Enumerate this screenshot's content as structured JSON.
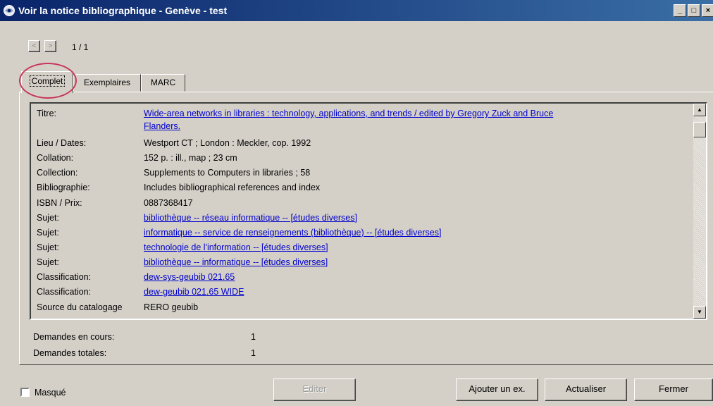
{
  "window": {
    "title": "Voir la notice bibliographique - Genève - test",
    "controls": {
      "minimize": "_",
      "maximize": "□",
      "close": "×"
    }
  },
  "navigation": {
    "prev": "<",
    "next": ">",
    "counter": "1 / 1"
  },
  "tabs": [
    {
      "label": "Complet",
      "active": true
    },
    {
      "label": "Exemplaires",
      "active": false
    },
    {
      "label": "MARC",
      "active": false
    }
  ],
  "record": {
    "rows": [
      {
        "label": "Titre:",
        "value": "Wide-area networks in libraries : technology, applications, and trends / edited by Gregory Zuck and Bruce",
        "value_cont": "Flanders.",
        "link": true
      },
      {
        "label": "Lieu / Dates:",
        "value": "Westport CT ; London : Meckler, cop. 1992",
        "link": false
      },
      {
        "label": "Collation:",
        "value": "152 p. : ill., map ; 23 cm",
        "link": false
      },
      {
        "label": "Collection:",
        "value": "Supplements to Computers in libraries ; 58",
        "link": false
      },
      {
        "label": "Bibliographie:",
        "value": "Includes bibliographical references and index",
        "link": false
      },
      {
        "label": "ISBN / Prix:",
        "value": "0887368417",
        "link": false
      },
      {
        "label": "Sujet:",
        "value": "bibliothèque -- réseau informatique -- [études diverses]",
        "link": true
      },
      {
        "label": "Sujet:",
        "value": "informatique -- service de renseignements (bibliothèque) -- [études diverses]",
        "link": true
      },
      {
        "label": "Sujet:",
        "value": "technologie de l'information -- [études diverses]",
        "link": true
      },
      {
        "label": "Sujet:",
        "value": "bibliothèque -- informatique -- [études diverses]",
        "link": true
      },
      {
        "label": "Classification:",
        "value": "dew-sys-geubib 021.65",
        "link": true
      },
      {
        "label": "Classification:",
        "value": "dew-geubib 021.65 WIDE",
        "link": true
      },
      {
        "label": "Source du catalogage",
        "value": "RERO geubib",
        "link": false
      }
    ]
  },
  "requests": {
    "current_label": "Demandes en cours:",
    "current_value": "1",
    "total_label": "Demandes totales:",
    "total_value": "1"
  },
  "footer": {
    "hidden_label": "Masqué",
    "hidden_checked": false,
    "edit": "Editer",
    "add_copy": "Ajouter un ex.",
    "refresh": "Actualiser",
    "close": "Fermer"
  },
  "colors": {
    "titlebar": "#0a246a",
    "link": "#0000cc",
    "highlight_circle": "#c8365a",
    "face": "#d4d0c8"
  }
}
